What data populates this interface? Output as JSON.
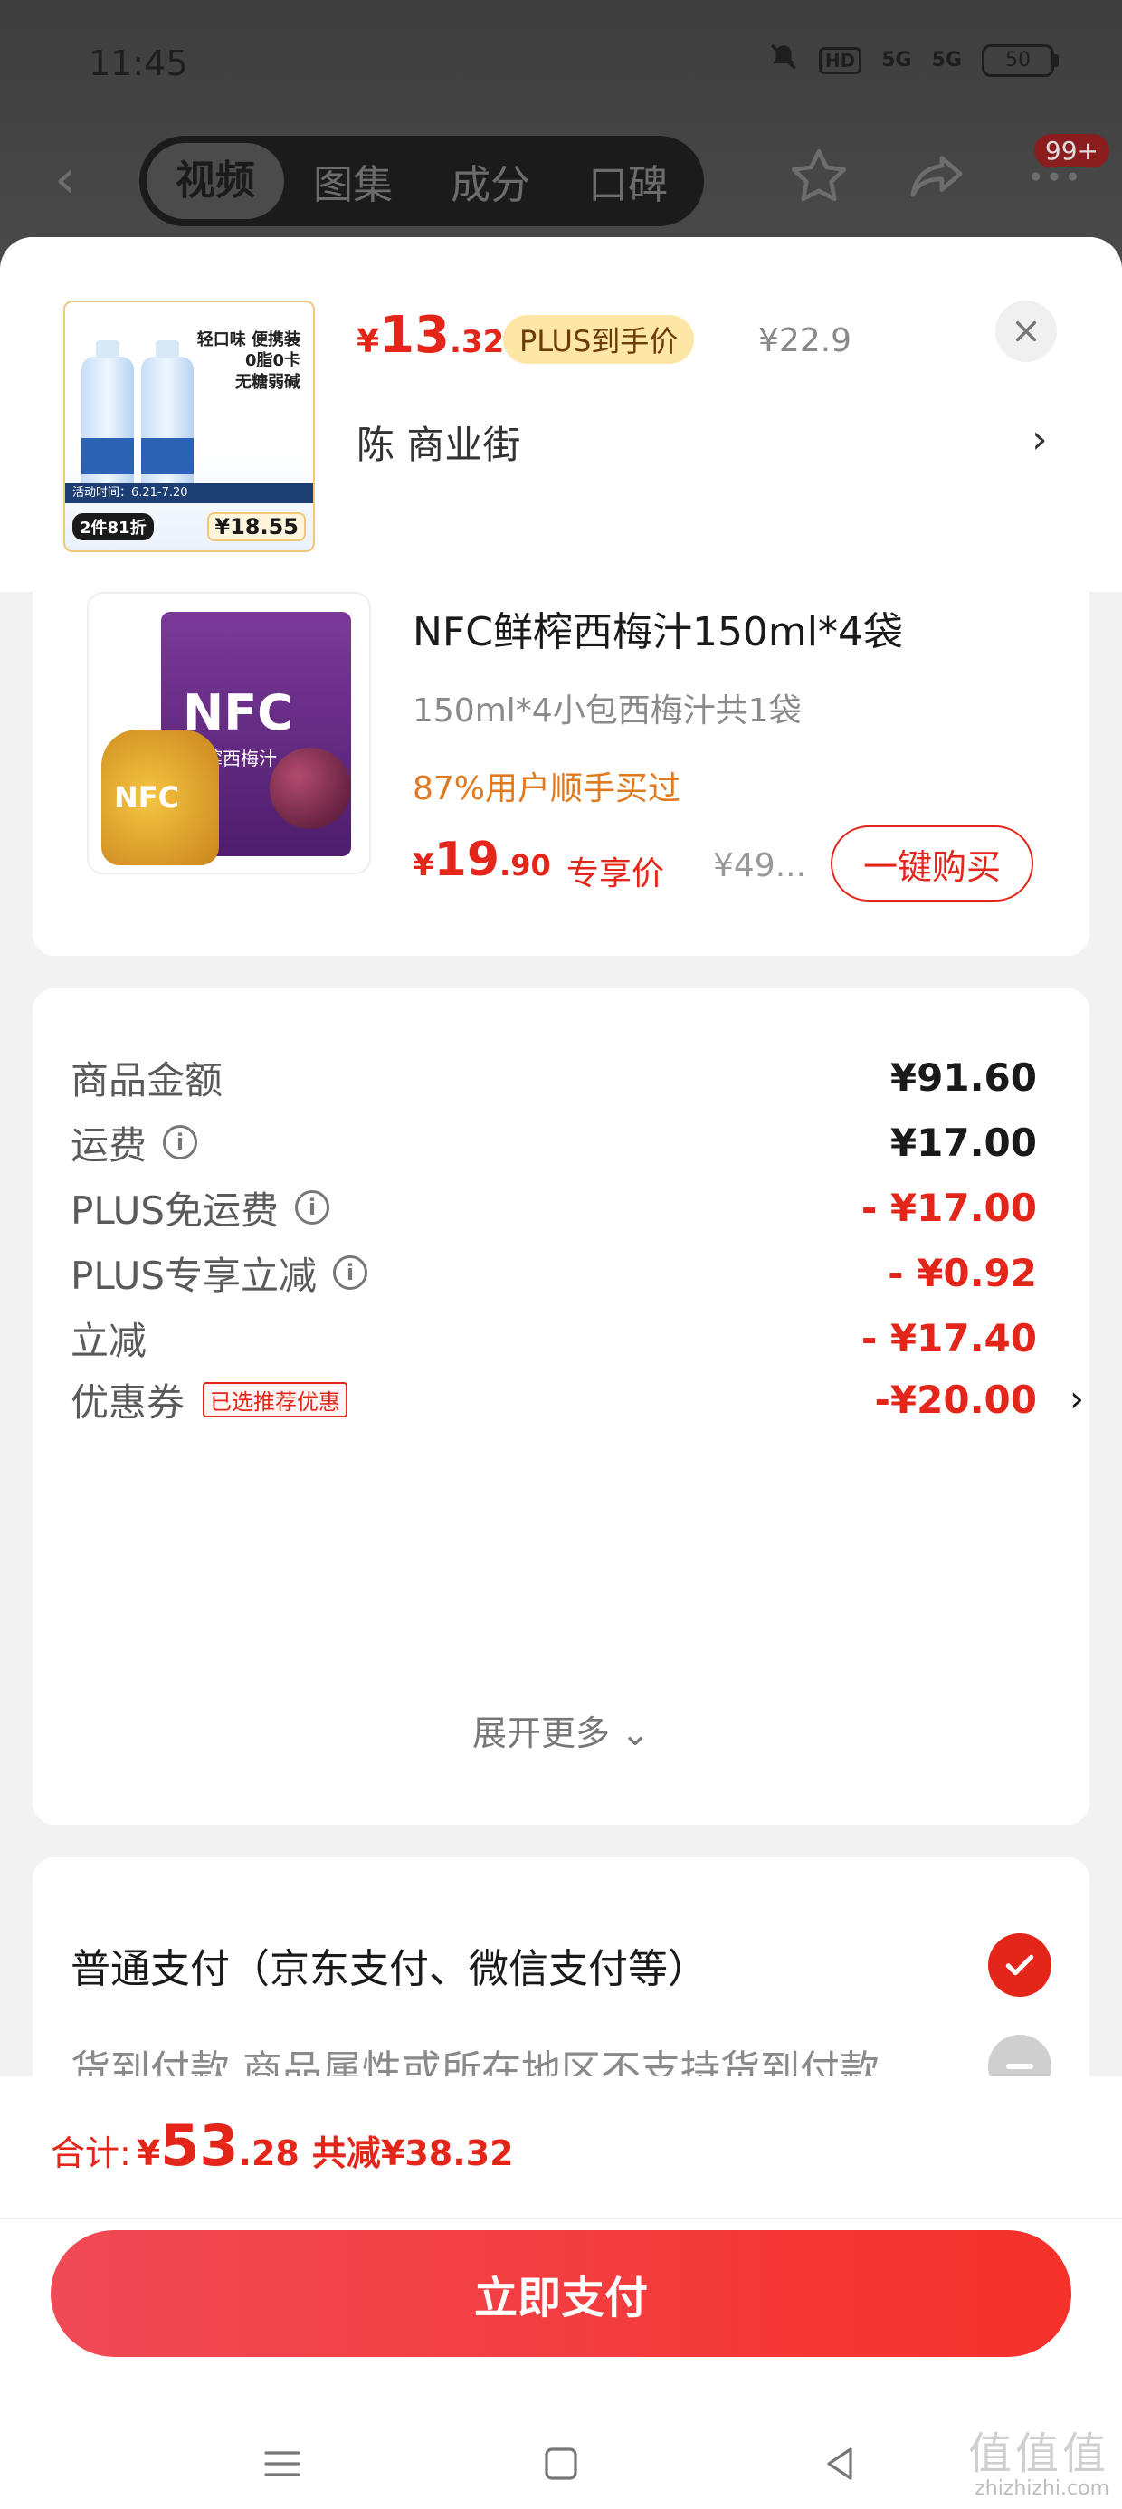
{
  "status_bar": {
    "time": "11:45",
    "hd": "HD",
    "sig1": "5G",
    "sig2": "5G",
    "battery": "50"
  },
  "top_nav": {
    "tabs": [
      "视频",
      "图集",
      "成分",
      "口碑"
    ],
    "active_tab": 0,
    "badge": "99+"
  },
  "header_product": {
    "thumb_tagline": "轻口味 便携装\n0脂0卡\n无糖弱碱",
    "thumb_strip": "活动时间：6.21-7.20",
    "thumb_offer": "2件81折",
    "thumb_price": "¥18.55",
    "price_currency": "¥",
    "price_int": "13",
    "price_dec": ".32",
    "plus_tag": "PLUS到手价",
    "original_price": "¥22.9",
    "seller": "陈  商业街",
    "chevron": "›"
  },
  "recommended_product": {
    "image_text": "NFC",
    "image_sub": "鲜榨西梅汁",
    "title": "NFC鲜榨西梅汁150ml*4袋",
    "subtitle": "150ml*4小包西梅汁共1袋",
    "bought_note": "87%用户顺手买过",
    "price_currency": "¥",
    "price_int": "19",
    "price_dec": ".90",
    "price_tag": "专享价",
    "original_price": "¥49...",
    "buy_button": "一键购买"
  },
  "summary": {
    "rows": [
      {
        "label": "商品金额",
        "value": "¥91.60"
      },
      {
        "label": "运费",
        "value": "¥17.00"
      },
      {
        "label": "PLUS免运费",
        "value": "- ¥17.00"
      },
      {
        "label": "PLUS专享立减",
        "value": "- ¥0.92"
      },
      {
        "label": "立减",
        "value": "- ¥17.40"
      },
      {
        "label": "优惠券",
        "tag": "已选推荐优惠",
        "value": "-¥20.00"
      }
    ],
    "expand_label": "展开更多 ⌄",
    "info_glyph": "i",
    "chevron": "›"
  },
  "payment": {
    "option_normal": "普通支付（京东支付、微信支付等）",
    "option_cod": "货到付款 商品属性或所在地区不支持货到付款"
  },
  "footer": {
    "total_label": "合计:",
    "total_currency": "¥",
    "total_int": "53",
    "total_dec": ".28",
    "saved": "共减¥38.32",
    "pay_button": "立即支付"
  },
  "watermark": {
    "logo": "值值值",
    "domain": "zhizhizhi.com"
  },
  "colors": {
    "accent": "#e4261a",
    "plus_tag_bg": "#fde6a6",
    "orange_note": "#e07a1f"
  }
}
